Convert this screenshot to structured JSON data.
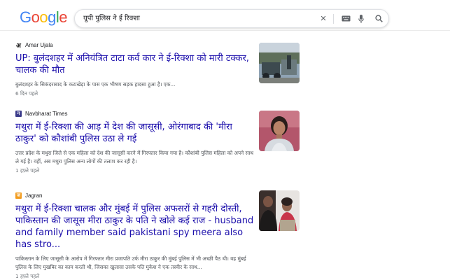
{
  "header": {
    "logo": "Google",
    "logo_colors": [
      "#4285F4",
      "#EA4335",
      "#FBBC05",
      "#4285F4",
      "#34A853",
      "#EA4335"
    ],
    "search_value": "यूपी पुलिस ने ई रिक्शा",
    "icons": [
      "close-icon",
      "keyboard-icon",
      "microphone-icon",
      "search-icon"
    ]
  },
  "results": [
    {
      "source": "Amar Ujala",
      "favicon_letter": "अ",
      "favicon_color": "#1a1a1a",
      "title": "UP: बुलंदशहर में अनियंत्रित टाटा कर्व कार ने ई-रिक्शा को मारी टक्कर, चालक की मौत",
      "snippet": "बुलंदशहर के सिकंदराबाद के कटाखेड़ा के पास एक भीषण सड़क हादसा हुआ है। एक...",
      "age": "6 दिन पहले"
    },
    {
      "source": "Navbharat Times",
      "favicon_letter": "न",
      "favicon_color": "#3b3b8a",
      "title": "मथुरा में ई-रिक्शा की आड़ में देश की जासूसी, ओरंगाबाद की 'मीरा ठाकुर' को कौशांबी पुलिस उठा ले गई",
      "snippet": "उत्तर प्रदेश के मथुरा जिले से एक महिला को देश की जासूसी करने में गिरफ्तार किया गया है। कौशांबी पुलिस महिला को अपने साथ ले गई है। वहीं, अब मथुरा पुलिस अन्य लोगों की तलाश कर रही है।",
      "age": "1 हफ़्ते पहले"
    },
    {
      "source": "Jagran",
      "favicon_letter": "ज",
      "favicon_color": "#f29b1d",
      "title": "मथुरा में ई-रिक्शा चालक और मुंबई में पुलिस अफसरों से गहरी दोस्ती, पाकिस्तान की जासूस मीरा ठाकुर के पति ने खोले कई राज - husband and family member said pakistani spy meera also has stro...",
      "snippet": "पाकिस्तान के लिए जासूसी के आरोप में गिरफ्तार मीरा प्रजापति उर्फ मीरा ठाकुर की मुंबई पुलिस में भी अच्छी पैठ थी। वह मुंबई पुलिस के लिए मुखबिर का काम करती थी, जिसका खुलासा उसके पति मुकेश ने एक तस्वीर के साथ...",
      "age": "1 हफ़्ते पहले"
    }
  ]
}
